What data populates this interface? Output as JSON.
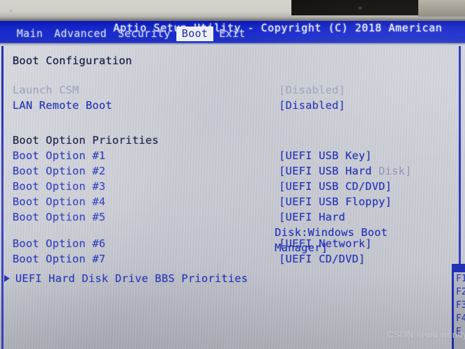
{
  "window": {
    "title": "Aptio Setup Utility - Copyright (C) 2018 American",
    "active_tab": "Boot"
  },
  "menu": {
    "items": [
      {
        "label": "Main",
        "active": false
      },
      {
        "label": "Advanced",
        "active": false
      },
      {
        "label": "Security",
        "active": false
      },
      {
        "label": "Boot",
        "active": true
      },
      {
        "label": "Exit",
        "active": false
      }
    ]
  },
  "main": {
    "section_title": "Boot Configuration",
    "settings": [
      {
        "label": "Launch CSM",
        "value": "[Disabled]",
        "state": "dim"
      },
      {
        "label": "LAN Remote Boot",
        "value": "[Disabled]",
        "state": "blue"
      }
    ],
    "priorities_title": "Boot Option Priorities",
    "boot_options": [
      {
        "label": "Boot Option #1",
        "value": "[UEFI USB Key]"
      },
      {
        "label": "Boot Option #2",
        "value": "[UEFI USB Hard ",
        "value_tail": "Disk]"
      },
      {
        "label": "Boot Option #3",
        "value": "[UEFI USB CD/DVD]"
      },
      {
        "label": "Boot Option #4",
        "value": "[UEFI USB Floppy]"
      },
      {
        "label": "Boot Option #5",
        "value": "[UEFI Hard",
        "value_line2": "Disk:Windows Boot",
        "value_line3": "Manager]"
      },
      {
        "label": "Boot Option #6",
        "value": "[UEFI Network]"
      },
      {
        "label": "Boot Option #7",
        "value": "[UEFI CD/DVD]"
      }
    ],
    "submenu": {
      "label": "UEFI Hard Disk Drive BBS Priorities",
      "marker": "right-triangle-icon"
    }
  },
  "help_panel": {
    "hotkeys": [
      "F1",
      "F2",
      "F3",
      "F4",
      "E"
    ]
  },
  "watermark": {
    "text": "CSDN @wu wendy"
  },
  "colors": {
    "title_bar": "#1527c8",
    "accent_blue": "#2433b5",
    "dim_text": "#9ba3bd",
    "header_text": "#101a3e",
    "field_bg": "#c2c5ce"
  }
}
